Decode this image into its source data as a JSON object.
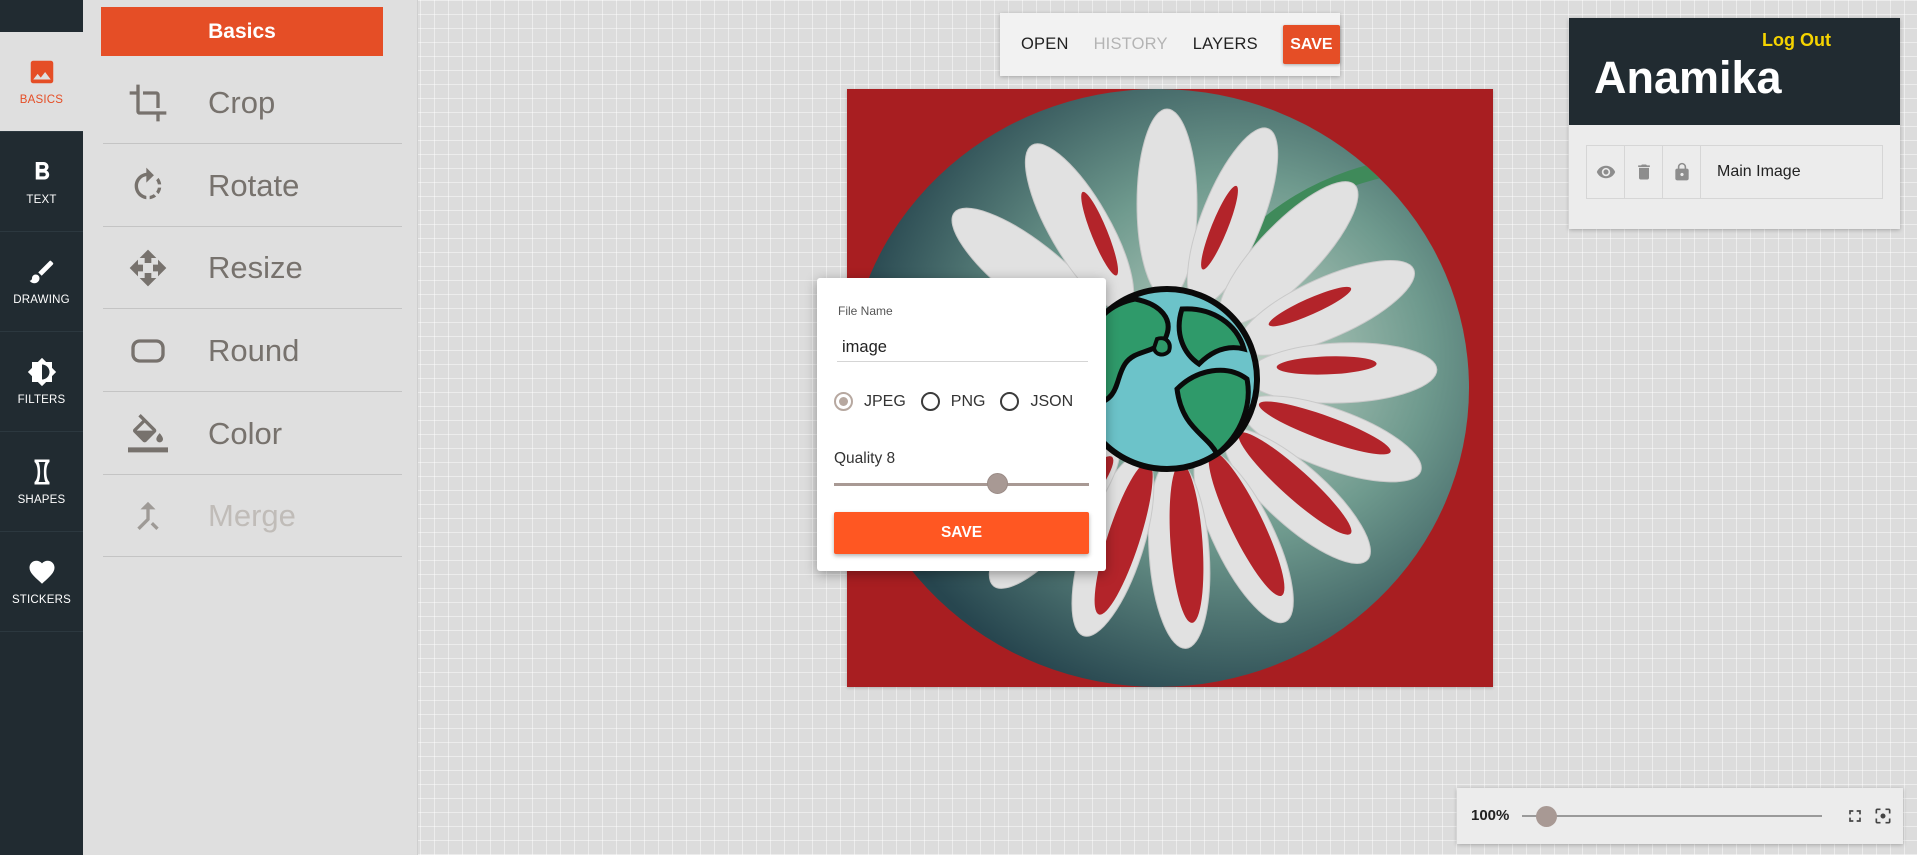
{
  "sidebar": {
    "items": [
      {
        "label": "BASICS",
        "icon": "image-icon",
        "active": true
      },
      {
        "label": "TEXT",
        "icon": "bold-icon"
      },
      {
        "label": "DRAWING",
        "icon": "brush-icon"
      },
      {
        "label": "FILTERS",
        "icon": "brightness-icon"
      },
      {
        "label": "SHAPES",
        "icon": "hourglass-shape-icon"
      },
      {
        "label": "STICKERS",
        "icon": "heart-icon"
      }
    ]
  },
  "panel": {
    "title": "Basics",
    "tools": [
      {
        "label": "Crop",
        "icon": "crop-icon"
      },
      {
        "label": "Rotate",
        "icon": "rotate-icon"
      },
      {
        "label": "Resize",
        "icon": "resize-icon"
      },
      {
        "label": "Round",
        "icon": "rounded-rect-icon"
      },
      {
        "label": "Color",
        "icon": "paint-bucket-icon"
      },
      {
        "label": "Merge",
        "icon": "merge-icon",
        "disabled": true
      }
    ]
  },
  "toolbar": {
    "open": "OPEN",
    "history": "HISTORY",
    "layers": "LAYERS",
    "save": "SAVE"
  },
  "dialog": {
    "file_name_label": "File Name",
    "file_name_value": "image",
    "formats": [
      {
        "label": "JPEG",
        "checked": true
      },
      {
        "label": "PNG",
        "checked": false
      },
      {
        "label": "JSON",
        "checked": false
      }
    ],
    "quality_label": "Quality 8",
    "quality_value": 8,
    "quality_max": 10,
    "save": "SAVE"
  },
  "user": {
    "logout": "Log Out",
    "name": "Anamika"
  },
  "layers": [
    {
      "name": "Main Image",
      "icons": [
        "eye-icon",
        "trash-icon",
        "lock-icon"
      ]
    }
  ],
  "zoom": {
    "label": "100%",
    "fraction": 0.08
  },
  "colors": {
    "accent": "#e54e26",
    "sidebar": "#212b31",
    "canvas_bg": "#a81e21",
    "logout": "#f5d300"
  }
}
